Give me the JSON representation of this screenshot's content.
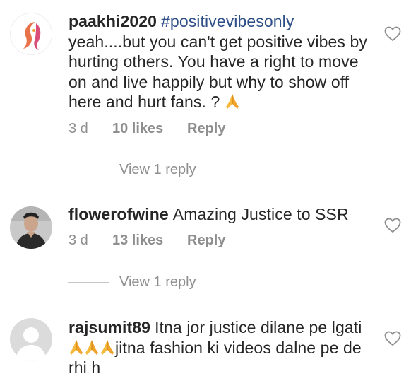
{
  "comments": [
    {
      "username": "paakhi2020",
      "hashtag": "#positivevibesonly",
      "text": "yeah....but you can't get positive vibes by hurting others.  You have a right to move on and live happily but why to show off here and hurt fans. ? ",
      "time": "3 d",
      "likes": "10 likes",
      "reply": "Reply",
      "view_replies": "View 1 reply",
      "avatar": "woman-silhouette-logo-icon"
    },
    {
      "username": "flowerofwine",
      "text": "Amazing Justice to SSR",
      "time": "3 d",
      "likes": "13 likes",
      "reply": "Reply",
      "view_replies": "View 1 reply",
      "avatar": "man-photo"
    },
    {
      "username": "rajsumit89",
      "text": "Itna jor justice dilane pe lgati ",
      "text_after_emoji": "jitna fashion ki videos dalne pe de rhi h",
      "avatar": "default-avatar-icon"
    }
  ],
  "colors": {
    "text": "#262626",
    "meta": "#8e8e8e",
    "hashtag": "#2d4e86",
    "pray_emoji": "#f6b93b"
  }
}
